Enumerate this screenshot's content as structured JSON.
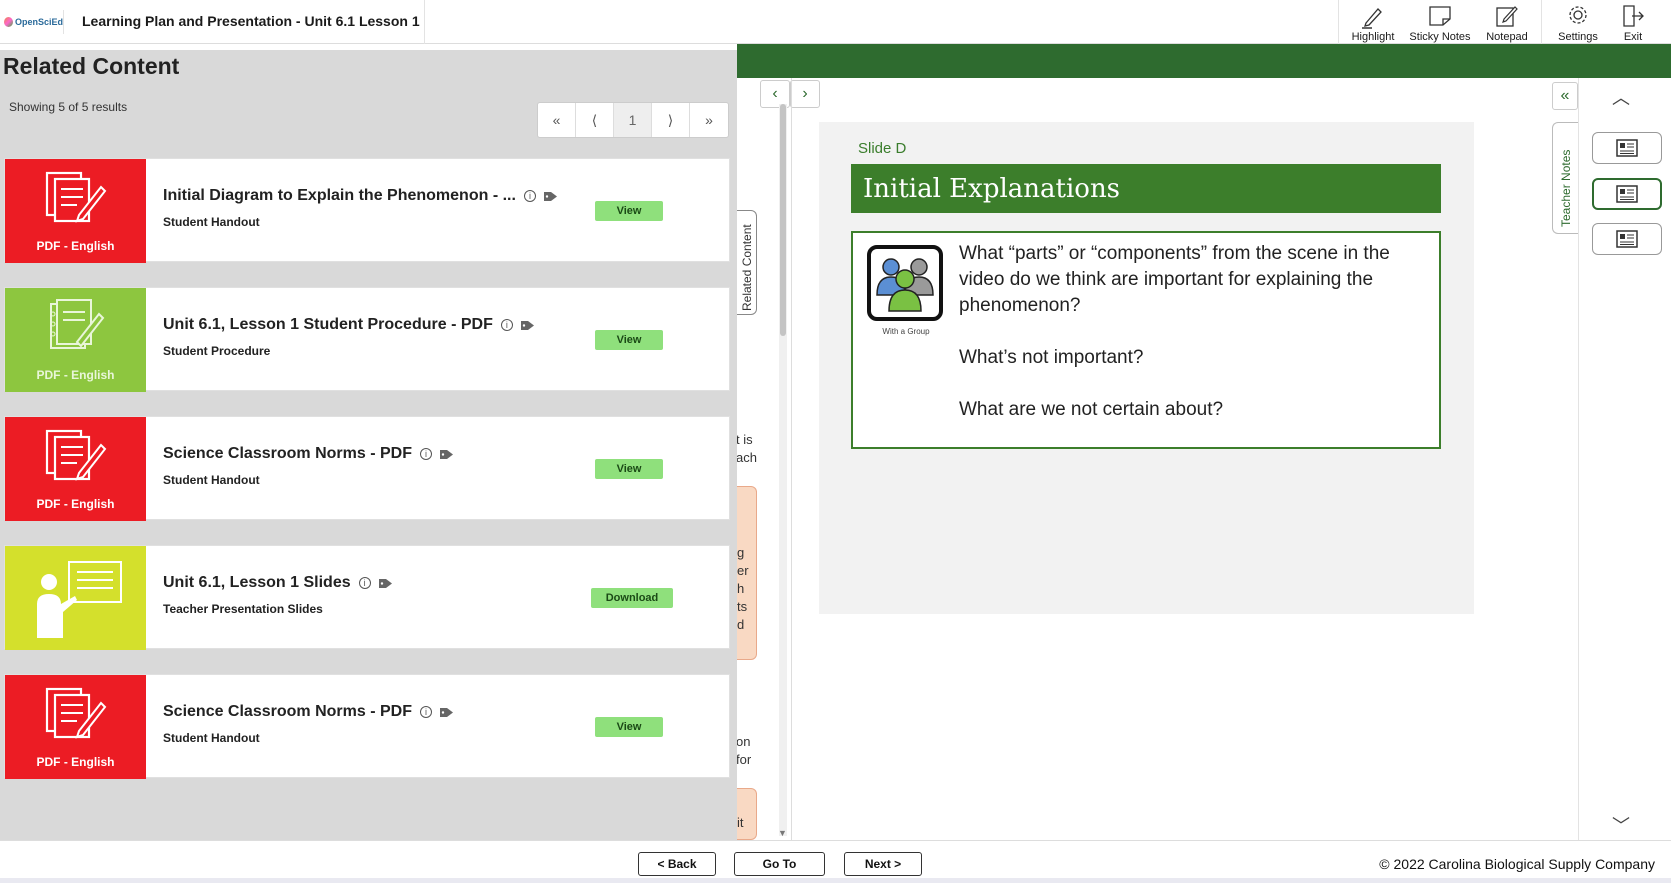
{
  "header": {
    "logo_text": "OpenSciEd",
    "title": "Learning Plan and Presentation - Unit 6.1 Lesson 1",
    "tools": [
      {
        "label": "Highlight",
        "icon": "pencil-icon"
      },
      {
        "label": "Sticky Notes",
        "icon": "sticky-note-icon"
      },
      {
        "label": "Notepad",
        "icon": "notepad-icon"
      },
      {
        "label": "Settings",
        "icon": "gear-icon"
      },
      {
        "label": "Exit",
        "icon": "exit-icon"
      }
    ]
  },
  "related": {
    "title": "Related Content",
    "count": "Showing 5 of 5 results",
    "pager": {
      "first": "«",
      "prev": "⟨",
      "page": "1",
      "next": "⟩",
      "last": "»"
    },
    "tab_label": "Related Content",
    "items": [
      {
        "thumb_label": "PDF - English",
        "thumb_color": "#ec1c24",
        "title": "Initial Diagram to Explain the Phenomenon - ...",
        "subtitle": "Student Handout",
        "button": "View"
      },
      {
        "thumb_label": "PDF - English",
        "thumb_color": "#8dc63f",
        "title": "Unit 6.1, Lesson 1 Student Procedure - PDF",
        "subtitle": "Student Procedure",
        "button": "View"
      },
      {
        "thumb_label": "PDF - English",
        "thumb_color": "#ec1c24",
        "title": "Science Classroom Norms - PDF",
        "subtitle": "Student Handout",
        "button": "View"
      },
      {
        "thumb_label": "",
        "thumb_color": "#d4e02c",
        "title": "Unit 6.1, Lesson 1 Slides",
        "subtitle": "Teacher Presentation Slides",
        "button": "Download"
      },
      {
        "thumb_label": "PDF - English",
        "thumb_color": "#ec1c24",
        "title": "Science Classroom Norms - PDF",
        "subtitle": "Student Handout",
        "button": "View"
      }
    ]
  },
  "peek_text": [
    "t is",
    "ach",
    "g",
    "er",
    "h",
    "ts",
    "d",
    "on",
    "for",
    "it"
  ],
  "slide": {
    "label": "Slide D",
    "banner": "Initial Explanations",
    "icon_caption": "With a Group",
    "questions": [
      "What “parts” or “components” from the scene in the video do we think are important for explaining the phenomenon?",
      "What’s not important?",
      "What are we not certain about?"
    ]
  },
  "teacher_notes": {
    "tab_label": "Teacher Notes",
    "collapse": "«",
    "up": "︿",
    "down": "﹀"
  },
  "nav": {
    "prev": "‹",
    "next": "›"
  },
  "footer": {
    "back": "< Back",
    "goto": "Go To",
    "next": "Next >",
    "copyright": "© 2022 Carolina Biological Supply Company"
  },
  "colors": {
    "brand_green": "#2e6b2f",
    "slide_green": "#3c7e2b",
    "view_button": "#8fe07c"
  }
}
